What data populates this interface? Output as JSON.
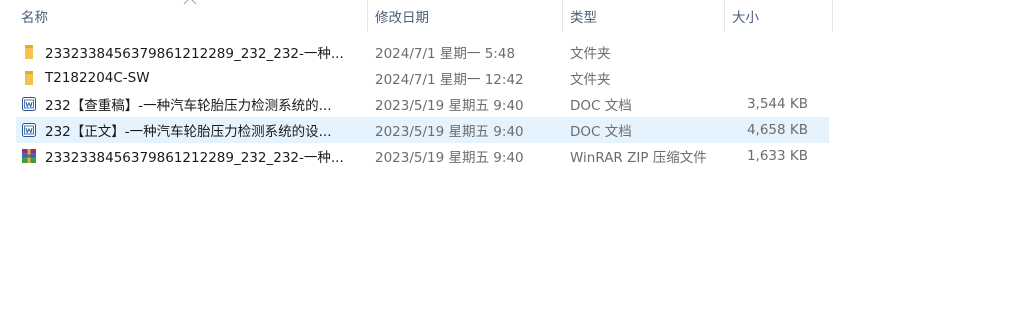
{
  "columns": {
    "name": "名称",
    "date": "修改日期",
    "type": "类型",
    "size": "大小"
  },
  "files": [
    {
      "name": "2332338456379861212289_232_232-一种...",
      "date": "2024/7/1 星期一 5:48",
      "type": "文件夹",
      "size": "",
      "icon": "folder-icon"
    },
    {
      "name": "T2182204C-SW",
      "date": "2024/7/1 星期一 12:42",
      "type": "文件夹",
      "size": "",
      "icon": "folder-icon"
    },
    {
      "name": "232【查重稿】-一种汽车轮胎压力检测系统的...",
      "date": "2023/5/19 星期五 9:40",
      "type": "DOC 文档",
      "size": "3,544 KB",
      "icon": "word-doc-icon"
    },
    {
      "name": "232【正文】-一种汽车轮胎压力检测系统的设...",
      "date": "2023/5/19 星期五 9:40",
      "type": "DOC 文档",
      "size": "4,658 KB",
      "icon": "word-doc-icon"
    },
    {
      "name": "2332338456379861212289_232_232-一种...",
      "date": "2023/5/19 星期五 9:40",
      "type": "WinRAR ZIP 压缩文件",
      "size": "1,633 KB",
      "icon": "winrar-archive-icon"
    }
  ],
  "colors": {
    "header_text": "#4c607a",
    "selected_row": "#e5f3ff",
    "folder": "#f4c24e",
    "word": "#2b5797",
    "winrar": "#9c2f6f"
  }
}
